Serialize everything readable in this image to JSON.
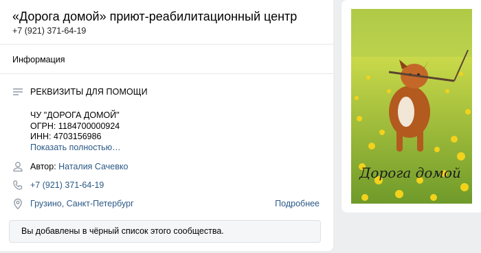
{
  "header": {
    "title": "«Дорога домой» приют-реабилитационный центр",
    "phone": "+7 (921) 371-64-19"
  },
  "tabs": {
    "info": "Информация"
  },
  "requisites": {
    "title": "РЕКВИЗИТЫ ДЛЯ ПОМОЩИ",
    "line1": "ЧУ \"ДОРОГА ДОМОЙ\"",
    "line2": "ОГРН: 1184700000924",
    "line3": "ИНН: 4703156986",
    "show_more": "Показать полностью…"
  },
  "author": {
    "label": "Автор:",
    "name": "Наталия Сачевко"
  },
  "contact": {
    "phone": "+7 (921) 371-64-19"
  },
  "location": {
    "text": "Грузино, Санкт-Петербург",
    "more": "Подробнее"
  },
  "notice": "Вы добавлены в чёрный список этого сообщества.",
  "photo": {
    "caption": "Дорога домой"
  },
  "colors": {
    "link": "#2a5885",
    "icon": "#99a2ad",
    "background": "#edeef0"
  }
}
